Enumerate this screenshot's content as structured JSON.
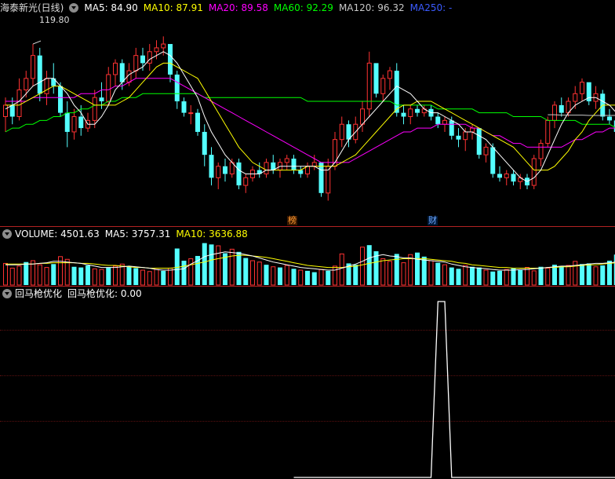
{
  "stock_header": {
    "name": "海泰新光(日线)",
    "ma5": "MA5: 84.90",
    "ma10": "MA10: 87.91",
    "ma20": "MA20: 89.58",
    "ma60": "MA60: 92.29",
    "ma120": "MA120: 96.32",
    "ma250": "MA250: -"
  },
  "price_high_label": "119.80",
  "event_badges": {
    "bang": "榜",
    "cai": "财"
  },
  "volume_header": {
    "volume": "VOLUME: 4501.63",
    "ma5": "MA5: 3757.31",
    "ma10": "MA10: 3636.88"
  },
  "indicator_header": {
    "name": "回马枪优化",
    "value_label": "回马枪优化: 0.00"
  },
  "colors": {
    "up": "#ff3232",
    "down": "#54ffff",
    "ma5": "#ffffff",
    "ma10": "#ffff00",
    "ma20": "#ff00ff",
    "ma60": "#00ff00",
    "ma120": "#c8c8c8",
    "ma250": "#3b5bff",
    "separator": "#b22222",
    "indicator_line": "#ffffff"
  },
  "chart_data": [
    {
      "type": "candlestick",
      "title": "海泰新光(日线)",
      "ylim": [
        70,
        122
      ],
      "candles": [
        [
          96,
          101,
          92,
          99
        ],
        [
          99,
          101,
          94,
          96
        ],
        [
          96,
          106,
          95,
          103
        ],
        [
          103,
          108,
          101,
          106
        ],
        [
          106,
          115,
          104,
          112
        ],
        [
          112,
          114,
          100,
          102
        ],
        [
          102,
          108,
          99,
          106
        ],
        [
          106,
          110,
          102,
          104
        ],
        [
          104,
          105,
          96,
          97
        ],
        [
          97,
          100,
          88,
          92
        ],
        [
          92,
          98,
          90,
          96
        ],
        [
          96,
          99,
          91,
          93
        ],
        [
          93,
          97,
          92,
          95
        ],
        [
          95,
          103,
          93,
          101
        ],
        [
          101,
          105,
          98,
          100
        ],
        [
          100,
          109,
          99,
          107
        ],
        [
          107,
          111,
          104,
          110
        ],
        [
          110,
          111,
          103,
          105
        ],
        [
          105,
          110,
          104,
          108
        ],
        [
          108,
          114,
          106,
          112
        ],
        [
          112,
          114,
          108,
          110
        ],
        [
          110,
          115,
          108,
          113
        ],
        [
          113,
          116,
          111,
          114
        ],
        [
          114,
          117,
          112,
          115
        ],
        [
          115,
          114,
          105,
          107
        ],
        [
          107,
          108,
          98,
          100
        ],
        [
          100,
          101,
          96,
          97
        ],
        [
          97,
          99,
          94,
          97
        ],
        [
          97,
          98,
          91,
          92
        ],
        [
          92,
          94,
          83,
          86
        ],
        [
          86,
          88,
          78,
          80
        ],
        [
          80,
          84,
          77,
          83
        ],
        [
          83,
          85,
          79,
          81
        ],
        [
          81,
          85,
          80,
          84
        ],
        [
          84,
          85,
          77,
          78
        ],
        [
          78,
          81,
          76,
          80
        ],
        [
          80,
          83,
          79,
          82
        ],
        [
          82,
          84,
          80,
          81
        ],
        [
          81,
          85,
          80,
          84
        ],
        [
          84,
          86,
          81,
          82
        ],
        [
          82,
          85,
          80,
          84
        ],
        [
          84,
          86,
          82,
          85
        ],
        [
          85,
          86,
          81,
          82
        ],
        [
          82,
          83,
          80,
          81
        ],
        [
          81,
          84,
          80,
          83
        ],
        [
          83,
          86,
          82,
          84
        ],
        [
          84,
          84,
          75,
          76
        ],
        [
          76,
          85,
          74,
          83
        ],
        [
          83,
          92,
          82,
          90
        ],
        [
          90,
          96,
          88,
          94
        ],
        [
          94,
          95,
          88,
          90
        ],
        [
          90,
          96,
          89,
          94
        ],
        [
          94,
          100,
          92,
          98
        ],
        [
          98,
          113,
          96,
          110
        ],
        [
          110,
          108,
          101,
          102
        ],
        [
          102,
          107,
          100,
          106
        ],
        [
          106,
          109,
          103,
          108
        ],
        [
          108,
          110,
          96,
          97
        ],
        [
          97,
          99,
          94,
          96
        ],
        [
          96,
          99,
          94,
          98
        ],
        [
          98,
          99,
          96,
          97
        ],
        [
          97,
          99,
          96,
          98
        ],
        [
          98,
          99,
          95,
          96
        ],
        [
          96,
          97,
          93,
          94
        ],
        [
          94,
          96,
          92,
          95
        ],
        [
          95,
          96,
          90,
          91
        ],
        [
          91,
          93,
          88,
          90
        ],
        [
          90,
          93,
          87,
          92
        ],
        [
          92,
          94,
          90,
          93
        ],
        [
          93,
          93,
          85,
          86
        ],
        [
          86,
          89,
          84,
          88
        ],
        [
          88,
          89,
          80,
          81
        ],
        [
          81,
          83,
          79,
          80
        ],
        [
          80,
          82,
          78,
          81
        ],
        [
          81,
          82,
          78,
          79
        ],
        [
          79,
          81,
          77,
          80
        ],
        [
          80,
          81,
          77,
          78
        ],
        [
          78,
          86,
          77,
          85
        ],
        [
          85,
          90,
          83,
          89
        ],
        [
          89,
          96,
          88,
          95
        ],
        [
          95,
          100,
          93,
          99
        ],
        [
          99,
          101,
          96,
          97
        ],
        [
          97,
          101,
          96,
          100
        ],
        [
          100,
          104,
          98,
          102
        ],
        [
          102,
          106,
          100,
          105
        ],
        [
          105,
          103,
          99,
          100
        ],
        [
          100,
          104,
          98,
          102
        ],
        [
          102,
          103,
          95,
          96
        ],
        [
          96,
          98,
          94,
          95
        ],
        [
          95,
          96,
          91,
          92
        ]
      ],
      "ma5": [
        98,
        99,
        100,
        102,
        104,
        105,
        106,
        106,
        104,
        102,
        99,
        97,
        94,
        94,
        96,
        99,
        103,
        105,
        107,
        108,
        109,
        111,
        112,
        113,
        112,
        110,
        107,
        104,
        101,
        96,
        92,
        89,
        86,
        84,
        82,
        81,
        81,
        81,
        82,
        82,
        83,
        83,
        83,
        83,
        83,
        83,
        82,
        82,
        84,
        87,
        90,
        92,
        94,
        96,
        98,
        100,
        102,
        104,
        103,
        102,
        100,
        98,
        97,
        97,
        96,
        95,
        94,
        92,
        92,
        91,
        90,
        88,
        86,
        84,
        82,
        80,
        79,
        80,
        82,
        86,
        90,
        94,
        97,
        99,
        100,
        101,
        101,
        100,
        99,
        97
      ],
      "ma10": [
        99,
        99,
        99,
        100,
        101,
        102,
        103,
        104,
        104,
        103,
        102,
        101,
        100,
        99,
        99,
        99,
        99,
        100,
        101,
        103,
        105,
        107,
        109,
        110,
        110,
        109,
        108,
        107,
        106,
        103,
        100,
        97,
        94,
        91,
        88,
        86,
        84,
        83,
        82,
        82,
        82,
        82,
        82,
        82,
        83,
        83,
        83,
        83,
        83,
        84,
        85,
        86,
        88,
        90,
        92,
        94,
        96,
        98,
        99,
        99,
        100,
        100,
        100,
        99,
        98,
        97,
        96,
        95,
        94,
        93,
        92,
        91,
        90,
        89,
        88,
        86,
        84,
        82,
        82,
        82,
        83,
        85,
        87,
        90,
        92,
        95,
        97,
        99,
        99,
        99
      ],
      "ma20": [
        100,
        100,
        100,
        100,
        101,
        101,
        101,
        101,
        101,
        101,
        101,
        102,
        102,
        102,
        103,
        103,
        104,
        104,
        105,
        106,
        106,
        106,
        106,
        106,
        106,
        105,
        104,
        103,
        102,
        101,
        100,
        99,
        98,
        97,
        96,
        95,
        94,
        93,
        92,
        91,
        90,
        89,
        88,
        87,
        86,
        85,
        84,
        84,
        84,
        84,
        84,
        85,
        86,
        87,
        88,
        89,
        90,
        91,
        92,
        92,
        93,
        93,
        93,
        94,
        94,
        94,
        94,
        94,
        93,
        93,
        92,
        91,
        91,
        90,
        89,
        89,
        88,
        88,
        88,
        88,
        88,
        88,
        89,
        90,
        90,
        91,
        92,
        92,
        93,
        93
      ],
      "ma60": [
        92,
        93,
        93,
        94,
        94,
        95,
        95,
        96,
        96,
        97,
        97,
        98,
        98,
        99,
        99,
        100,
        100,
        101,
        101,
        101,
        102,
        102,
        102,
        102,
        102,
        102,
        102,
        102,
        102,
        101,
        101,
        101,
        101,
        101,
        101,
        101,
        101,
        101,
        101,
        101,
        101,
        101,
        101,
        101,
        100,
        100,
        100,
        100,
        100,
        100,
        100,
        100,
        100,
        100,
        100,
        100,
        100,
        99,
        99,
        99,
        99,
        99,
        99,
        98,
        98,
        98,
        98,
        98,
        98,
        97,
        97,
        97,
        97,
        97,
        96,
        96,
        96,
        96,
        96,
        95,
        95,
        95,
        95,
        95,
        94,
        94,
        94,
        94,
        94,
        93
      ],
      "ma120": [
        null,
        null,
        null,
        null,
        null,
        null,
        null,
        null,
        null,
        null,
        null,
        null,
        null,
        null,
        null,
        null,
        null,
        null,
        null,
        null,
        null,
        null,
        null,
        null,
        null,
        null,
        null,
        null,
        null,
        null,
        null,
        null,
        null,
        null,
        null,
        null,
        null,
        null,
        null,
        null,
        null,
        null,
        null,
        null,
        null,
        null,
        null,
        null,
        null,
        null,
        null,
        null,
        null,
        null,
        null,
        null,
        null,
        null,
        null,
        null,
        null,
        null,
        null,
        null,
        null,
        null,
        null,
        null,
        null,
        null,
        null,
        null,
        null,
        null,
        null,
        null,
        null,
        null,
        null,
        96.5,
        96.5,
        96.4,
        96.4,
        96.4,
        96.4,
        96.3,
        96.3,
        96.3,
        96.3,
        96.3
      ]
    },
    {
      "type": "bar",
      "title": "VOLUME",
      "ylim": [
        0,
        6500
      ],
      "values": [
        3200,
        2500,
        2800,
        3400,
        3600,
        3000,
        2600,
        3100,
        4200,
        3800,
        2700,
        2600,
        2900,
        2400,
        2300,
        2600,
        2800,
        3100,
        2700,
        2500,
        2200,
        2000,
        2300,
        2100,
        2500,
        5400,
        3600,
        3900,
        4300,
        6200,
        6000,
        5800,
        4700,
        5300,
        4900,
        4000,
        3600,
        3400,
        3000,
        2700,
        2600,
        2900,
        2400,
        2200,
        2100,
        1900,
        2300,
        2100,
        2800,
        4600,
        3200,
        3000,
        5600,
        5900,
        5000,
        3900,
        3500,
        4600,
        3300,
        4500,
        4800,
        4200,
        3600,
        3300,
        3000,
        2600,
        2400,
        2900,
        2700,
        2600,
        2200,
        2000,
        2100,
        2300,
        2500,
        2200,
        2600,
        2100,
        2700,
        2500,
        3000,
        2800,
        2900,
        3500,
        3100,
        3200,
        2700,
        2900,
        3600,
        4501.63
      ],
      "up": [
        1,
        1,
        1,
        0,
        1,
        1,
        1,
        0,
        1,
        1,
        0,
        0,
        0,
        1,
        1,
        0,
        1,
        1,
        0,
        0,
        1,
        1,
        1,
        0,
        1,
        0,
        0,
        1,
        0,
        0,
        0,
        1,
        0,
        1,
        0,
        0,
        1,
        1,
        0,
        1,
        0,
        1,
        0,
        1,
        0,
        0,
        1,
        0,
        1,
        1,
        0,
        0,
        1,
        0,
        0,
        1,
        1,
        0,
        1,
        1,
        0,
        0,
        1,
        0,
        1,
        0,
        0,
        1,
        0,
        0,
        1,
        0,
        0,
        1,
        0,
        0,
        1,
        1,
        0,
        1,
        0,
        0,
        1,
        1,
        0,
        0,
        1,
        0,
        0,
        0
      ],
      "ma5": [
        3000,
        3000,
        3000,
        3100,
        3100,
        3200,
        3300,
        3500,
        3500,
        3400,
        3300,
        3200,
        3000,
        2800,
        2600,
        2600,
        2600,
        2700,
        2800,
        2700,
        2600,
        2500,
        2300,
        2200,
        2200,
        2300,
        2400,
        3100,
        3600,
        4200,
        4500,
        4700,
        4900,
        4800,
        4700,
        4500,
        4300,
        4000,
        3700,
        3400,
        3200,
        3000,
        2800,
        2600,
        2500,
        2400,
        2300,
        2200,
        2200,
        2500,
        2800,
        3100,
        3500,
        4000,
        4300,
        4500,
        4300,
        4200,
        4000,
        4000,
        3800,
        3700,
        3600,
        3500,
        3400,
        3100,
        2900,
        2700,
        2600,
        2500,
        2400,
        2300,
        2200,
        2200,
        2200,
        2300,
        2300,
        2400,
        2500,
        2600,
        2700,
        2800,
        2800,
        2900,
        3000,
        3100,
        3200,
        3200,
        3300,
        3400
      ],
      "ma10": [
        3100,
        3100,
        3100,
        3100,
        3100,
        3200,
        3200,
        3300,
        3300,
        3300,
        3300,
        3200,
        3200,
        3100,
        3000,
        2900,
        2900,
        2800,
        2700,
        2600,
        2600,
        2500,
        2500,
        2500,
        2500,
        2600,
        2800,
        3000,
        3200,
        3400,
        3700,
        3900,
        4100,
        4300,
        4400,
        4400,
        4300,
        4200,
        4100,
        3900,
        3700,
        3500,
        3300,
        3100,
        2900,
        2800,
        2700,
        2600,
        2600,
        2600,
        2700,
        2800,
        3000,
        3200,
        3400,
        3600,
        3700,
        3800,
        3900,
        3900,
        3900,
        3900,
        3800,
        3700,
        3600,
        3500,
        3300,
        3200,
        3000,
        2900,
        2800,
        2700,
        2600,
        2600,
        2500,
        2500,
        2500,
        2500,
        2500,
        2600,
        2600,
        2700,
        2700,
        2800,
        2900,
        3000,
        3000,
        3100,
        3200,
        3300
      ]
    },
    {
      "type": "line",
      "title": "回马枪优化",
      "ylim": [
        0,
        1
      ],
      "values": [
        0,
        0,
        0,
        0,
        0,
        0,
        0,
        0,
        0,
        0,
        0,
        0,
        0,
        0,
        0,
        0,
        0,
        0,
        0,
        0,
        0,
        0,
        0,
        0,
        0,
        0,
        0,
        0,
        0,
        0,
        0,
        0,
        0,
        0,
        0,
        0,
        0,
        0,
        0,
        0,
        0,
        0,
        0,
        0,
        0,
        0,
        0,
        0,
        0,
        0,
        0,
        0,
        0,
        0,
        0,
        0,
        0,
        0,
        0,
        0,
        0,
        0,
        0,
        1,
        1,
        0,
        0,
        0,
        0,
        0,
        0,
        0,
        0,
        0,
        0,
        0,
        0,
        0,
        0,
        0,
        0,
        0,
        0,
        0,
        0,
        0,
        0,
        0,
        0,
        0
      ]
    }
  ]
}
